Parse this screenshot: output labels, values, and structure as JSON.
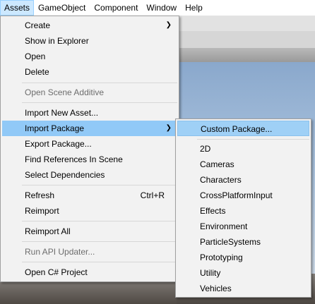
{
  "menubar": {
    "items": [
      "Assets",
      "GameObject",
      "Component",
      "Window",
      "Help"
    ]
  },
  "assets_menu": {
    "items": [
      {
        "label": "Create",
        "submenu": true
      },
      {
        "label": "Show in Explorer"
      },
      {
        "label": "Open"
      },
      {
        "label": "Delete"
      },
      {
        "label": "Open Scene Additive",
        "disabled": true
      },
      {
        "label": "Import New Asset..."
      },
      {
        "label": "Import Package",
        "submenu": true,
        "highlighted": true
      },
      {
        "label": "Export Package..."
      },
      {
        "label": "Find References In Scene"
      },
      {
        "label": "Select Dependencies"
      },
      {
        "label": "Refresh",
        "shortcut": "Ctrl+R"
      },
      {
        "label": "Reimport"
      },
      {
        "label": "Reimport All"
      },
      {
        "label": "Run API Updater...",
        "disabled": true
      },
      {
        "label": "Open C# Project"
      }
    ]
  },
  "import_package_menu": {
    "items": [
      {
        "label": "Custom Package...",
        "highlighted": true
      },
      {
        "label": "2D"
      },
      {
        "label": "Cameras"
      },
      {
        "label": "Characters"
      },
      {
        "label": "CrossPlatformInput"
      },
      {
        "label": "Effects"
      },
      {
        "label": "Environment"
      },
      {
        "label": "ParticleSystems"
      },
      {
        "label": "Prototyping"
      },
      {
        "label": "Utility"
      },
      {
        "label": "Vehicles"
      }
    ]
  },
  "icons": {
    "submenu_arrow": "chevron-right-icon"
  },
  "colors": {
    "highlight": "#91c9f7",
    "menubar_active": "#cce8ff",
    "menu_background": "#f2f2f2"
  }
}
